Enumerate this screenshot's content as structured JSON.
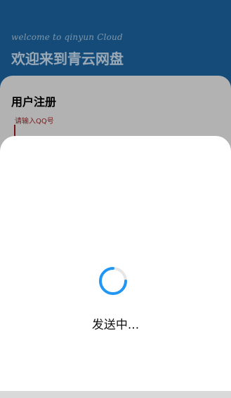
{
  "header": {
    "welcome_text": "welcome to qinyun Cloud",
    "app_title": "欢迎来到青云网盘"
  },
  "registration": {
    "title": "用户注册",
    "qq_placeholder": "请输入QQ号"
  },
  "modal": {
    "status_text": "发送中..."
  },
  "colors": {
    "header_bg": "#1a5c93",
    "card_bg": "#d9d9d9",
    "spinner": "#2196f3",
    "label_red": "#8b0000"
  },
  "icons": {
    "spinner": "loading-spinner-icon"
  }
}
